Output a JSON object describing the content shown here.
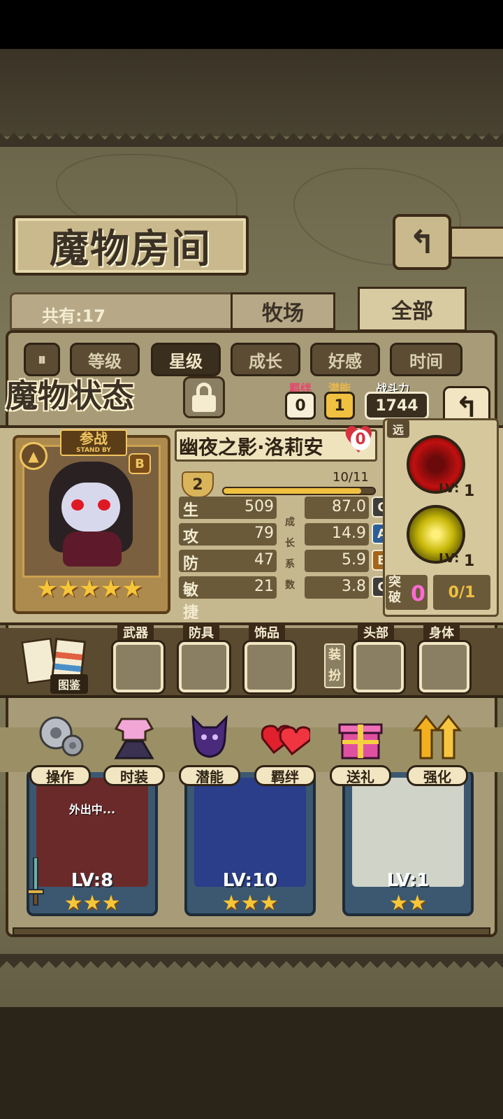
{
  "page_title": "魔物房间",
  "total_count": "共有:17",
  "tabs": [
    {
      "label": "牧场",
      "active": false
    },
    {
      "label": "全部",
      "active": true
    }
  ],
  "sort_buttons": [
    {
      "label": "等级",
      "active": false
    },
    {
      "label": "星级",
      "active": true
    },
    {
      "label": "成长",
      "active": false
    },
    {
      "label": "好感",
      "active": false
    },
    {
      "label": "时间",
      "active": false
    }
  ],
  "status": {
    "title": "魔物状态",
    "bond": {
      "label": "羁绊",
      "value": "0"
    },
    "potential": {
      "label": "潜能",
      "value": "1"
    },
    "power": {
      "label": "战斗力",
      "value": "1744"
    },
    "standby": {
      "main": "参战",
      "sub": "STAND BY"
    },
    "rank": "B",
    "stars": 5,
    "name": "幽夜之影·洛莉安",
    "affection": "0",
    "level": "2",
    "exp_text": "10/11",
    "exp_ratio": 0.91,
    "growth_chars": [
      "成",
      "长",
      "系",
      "数"
    ],
    "stats": [
      {
        "name": "生命",
        "value": "509",
        "growth": "87.0",
        "grade": "C"
      },
      {
        "name": "攻击",
        "value": "79",
        "growth": "14.9",
        "grade": "A"
      },
      {
        "name": "防御",
        "value": "47",
        "growth": "5.9",
        "grade": "B"
      },
      {
        "name": "敏捷",
        "value": "21",
        "growth": "3.8",
        "grade": "C"
      }
    ],
    "range": "远",
    "skills": [
      {
        "icon": "bat-skill-icon",
        "lv_prefix": "LV:",
        "lv": "1"
      },
      {
        "icon": "yellow-blast-skill-icon",
        "lv_prefix": "LV:",
        "lv": "1"
      }
    ],
    "breakthrough": {
      "label": "突破",
      "count": "0",
      "progress": "0/1"
    }
  },
  "equipment": {
    "book_label": "图鉴",
    "slots": [
      "武器",
      "防具",
      "饰品",
      "头部",
      "身体"
    ],
    "dress_tag": "装扮"
  },
  "actions": [
    {
      "label": "操作",
      "icon": "gear-icon"
    },
    {
      "label": "时装",
      "icon": "dress-icon"
    },
    {
      "label": "潜能",
      "icon": "demon-icon"
    },
    {
      "label": "羁绊",
      "icon": "hearts-icon"
    },
    {
      "label": "送礼",
      "icon": "gift-icon"
    },
    {
      "label": "强化",
      "icon": "up-arrows-icon"
    }
  ],
  "monster_cards": [
    {
      "lv": "LV:8",
      "stars": "★★★",
      "away_text": "外出中..."
    },
    {
      "lv": "LV:10",
      "stars": "★★★",
      "away_text": ""
    },
    {
      "lv": "LV:1",
      "stars": "★★",
      "away_text": ""
    }
  ],
  "colors": {
    "accent_gold": "#f0c040",
    "bond_pink": "#e8436f",
    "heart_red": "#d8323f"
  }
}
